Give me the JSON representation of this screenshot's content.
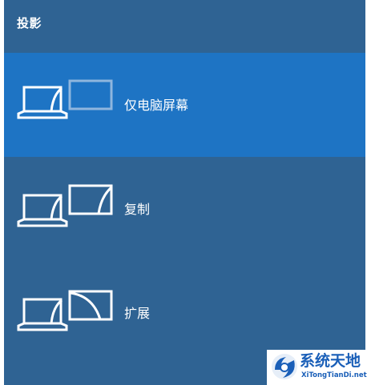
{
  "panel": {
    "title": "投影",
    "items": [
      {
        "label": "仅电脑屏幕",
        "icon": "pc-screen-only-icon",
        "selected": true
      },
      {
        "label": "复制",
        "icon": "duplicate-icon",
        "selected": false
      },
      {
        "label": "扩展",
        "icon": "extend-icon",
        "selected": false
      }
    ]
  },
  "watermark": {
    "name": "系统天地",
    "url": "XiTongTianDi.net"
  },
  "colors": {
    "panel_bg": "#2f6393",
    "selected_bg": "#1e74c4",
    "text": "#ffffff",
    "watermark_text": "#1a5fb8"
  }
}
